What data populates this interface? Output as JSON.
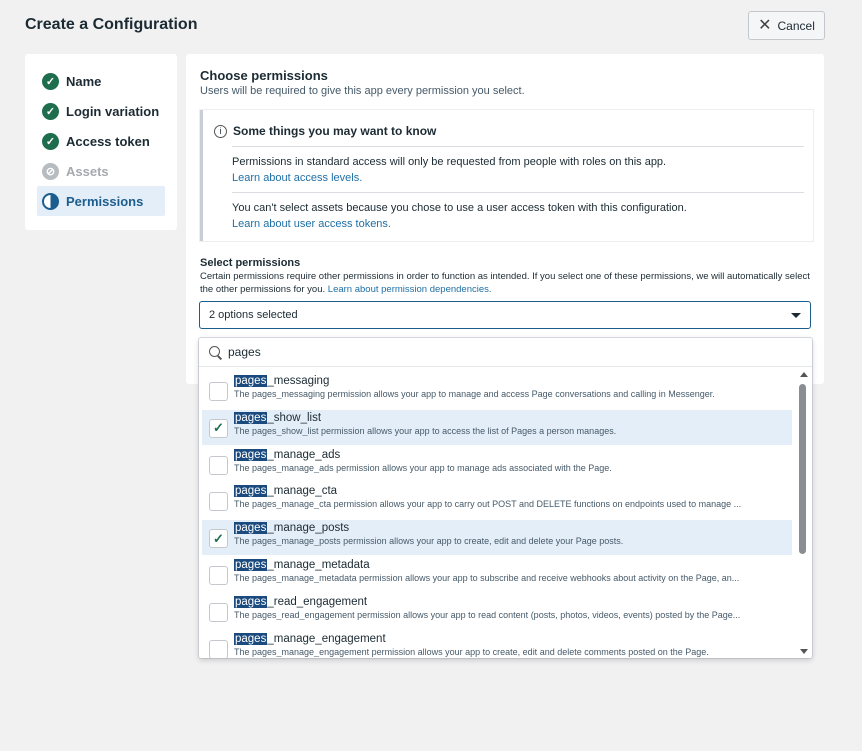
{
  "page": {
    "title": "Create a Configuration",
    "cancel_label": "Cancel"
  },
  "steps": [
    {
      "label": "Name",
      "state": "done"
    },
    {
      "label": "Login variation",
      "state": "done"
    },
    {
      "label": "Access token",
      "state": "done"
    },
    {
      "label": "Assets",
      "state": "disabled"
    },
    {
      "label": "Permissions",
      "state": "active"
    }
  ],
  "main": {
    "title": "Choose permissions",
    "subtitle": "Users will be required to give this app every permission you select.",
    "info": {
      "heading": "Some things you may want to know",
      "item1_text": "Permissions in standard access will only be requested from people with roles on this app.",
      "item1_link": "Learn about access levels.",
      "item2_text": "You can't select assets because you chose to use a user access token with this configuration.",
      "item2_link": "Learn about user access tokens."
    },
    "select_title": "Select permissions",
    "select_desc": "Certain permissions require other permissions in order to function as intended. If you select one of these permissions, we will automatically select the other permissions for you.",
    "select_desc_link": "Learn about permission dependencies.",
    "select_value": "2 options selected"
  },
  "dropdown": {
    "search_value": "pages",
    "highlight": "pages",
    "options": [
      {
        "suffix": "_messaging",
        "desc": "The pages_messaging permission allows your app to manage and access Page conversations and calling in Messenger.",
        "checked": false
      },
      {
        "suffix": "_show_list",
        "desc": "The pages_show_list permission allows your app to access the list of Pages a person manages.",
        "checked": true
      },
      {
        "suffix": "_manage_ads",
        "desc": "The pages_manage_ads permission allows your app to manage ads associated with the Page.",
        "checked": false
      },
      {
        "suffix": "_manage_cta",
        "desc": "The pages_manage_cta permission allows your app to carry out POST and DELETE functions on endpoints used to manage ...",
        "checked": false
      },
      {
        "suffix": "_manage_posts",
        "desc": "The pages_manage_posts permission allows your app to create, edit and delete your Page posts.",
        "checked": true
      },
      {
        "suffix": "_manage_metadata",
        "desc": "The pages_manage_metadata permission allows your app to subscribe and receive webhooks about activity on the Page, an...",
        "checked": false
      },
      {
        "suffix": "_read_engagement",
        "desc": "The pages_read_engagement permission allows your app to read content (posts, photos, videos, events) posted by the Page...",
        "checked": false
      },
      {
        "suffix": "_manage_engagement",
        "desc": "The pages_manage_engagement permission allows your app to create, edit and delete comments posted on the Page.",
        "checked": false
      }
    ]
  }
}
